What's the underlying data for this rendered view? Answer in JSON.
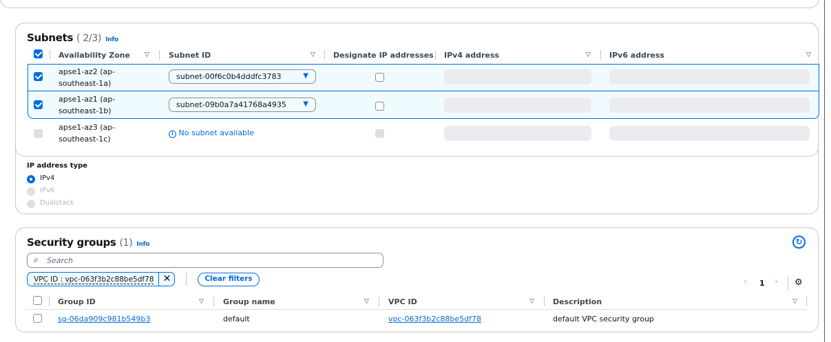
{
  "subnets": {
    "title": "Subnets",
    "count": "( 2/3)",
    "info": "Info",
    "columns": [
      "Availability Zone",
      "Subnet ID",
      "Designate IP addresses",
      "IPv4 address",
      "IPv6 address"
    ],
    "rows": [
      {
        "az_line1": "apse1-az2 (ap-",
        "az_line2": "southeast-1a)",
        "subnet": "subnet-00f6c0b4dddfc3783",
        "checked": true
      },
      {
        "az_line1": "apse1-az1 (ap-",
        "az_line2": "southeast-1b)",
        "subnet": "subnet-09b0a7a41768a4935",
        "checked": true
      },
      {
        "az_line1": "apse1-az3 (ap-",
        "az_line2": "southeast-1c)",
        "subnet": "No subnet available",
        "checked": false,
        "disabled": true
      }
    ]
  },
  "ip_type": {
    "label": "IP address type",
    "options": [
      "IPv4",
      "IPv6",
      "Dualstack"
    ],
    "selected": "IPv4"
  },
  "security": {
    "title": "Security groups",
    "count": "(1)",
    "info": "Info",
    "search_placeholder": "Search",
    "filter": "VPC ID : vpc-063f3b2c88be5df78",
    "clear": "Clear filters",
    "page": "1",
    "columns": [
      "Group ID",
      "Group name",
      "VPC ID",
      "Description"
    ],
    "rows": [
      {
        "group_id": "sg-06da909c981b549b3",
        "name": "default",
        "vpc": "vpc-063f3b2c88be5df78",
        "desc": "default VPC security group"
      }
    ]
  },
  "colors": {
    "accent": "#006ce0",
    "selected_row": "#f0fbff"
  }
}
